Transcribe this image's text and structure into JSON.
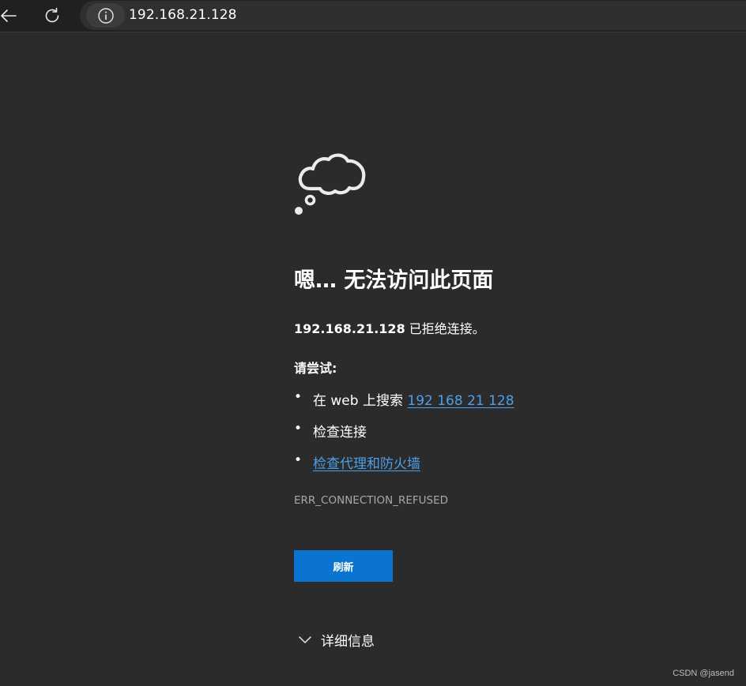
{
  "browser": {
    "url": "192.168.21.128",
    "back_icon": "back-arrow-icon",
    "refresh_icon": "refresh-icon",
    "info_icon": "info-icon"
  },
  "error_page": {
    "icon": "thought-cloud-icon",
    "heading": "嗯… 无法访问此页面",
    "host": "192.168.21.128",
    "message_suffix": " 已拒绝连接。",
    "try_label": "请尝试:",
    "suggestions": [
      {
        "prefix": "在 web 上搜索 ",
        "link": "192 168 21 128"
      },
      {
        "text": "检查连接"
      },
      {
        "link": "检查代理和防火墙"
      }
    ],
    "error_code": "ERR_CONNECTION_REFUSED",
    "refresh_label": "刷新",
    "details_label": "详细信息"
  },
  "watermark": "CSDN @jasend",
  "colors": {
    "background": "#2b2b2b",
    "link": "#4ca0e8",
    "button": "#0b74d0",
    "error_code": "#a8a8a8"
  }
}
